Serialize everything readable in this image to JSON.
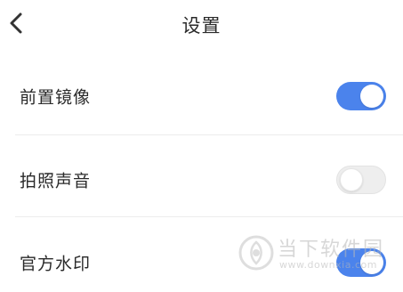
{
  "header": {
    "title": "设置",
    "back_icon": "chevron-left-icon"
  },
  "settings": [
    {
      "label": "前置镜像",
      "enabled": true
    },
    {
      "label": "拍照声音",
      "enabled": false
    },
    {
      "label": "官方水印",
      "enabled": true
    }
  ],
  "colors": {
    "toggle_on": "#4b83ec",
    "toggle_off": "#eeeeee",
    "divider": "#ececec"
  },
  "watermark": {
    "text": "当下软件园",
    "url": "www.downxia.com"
  }
}
